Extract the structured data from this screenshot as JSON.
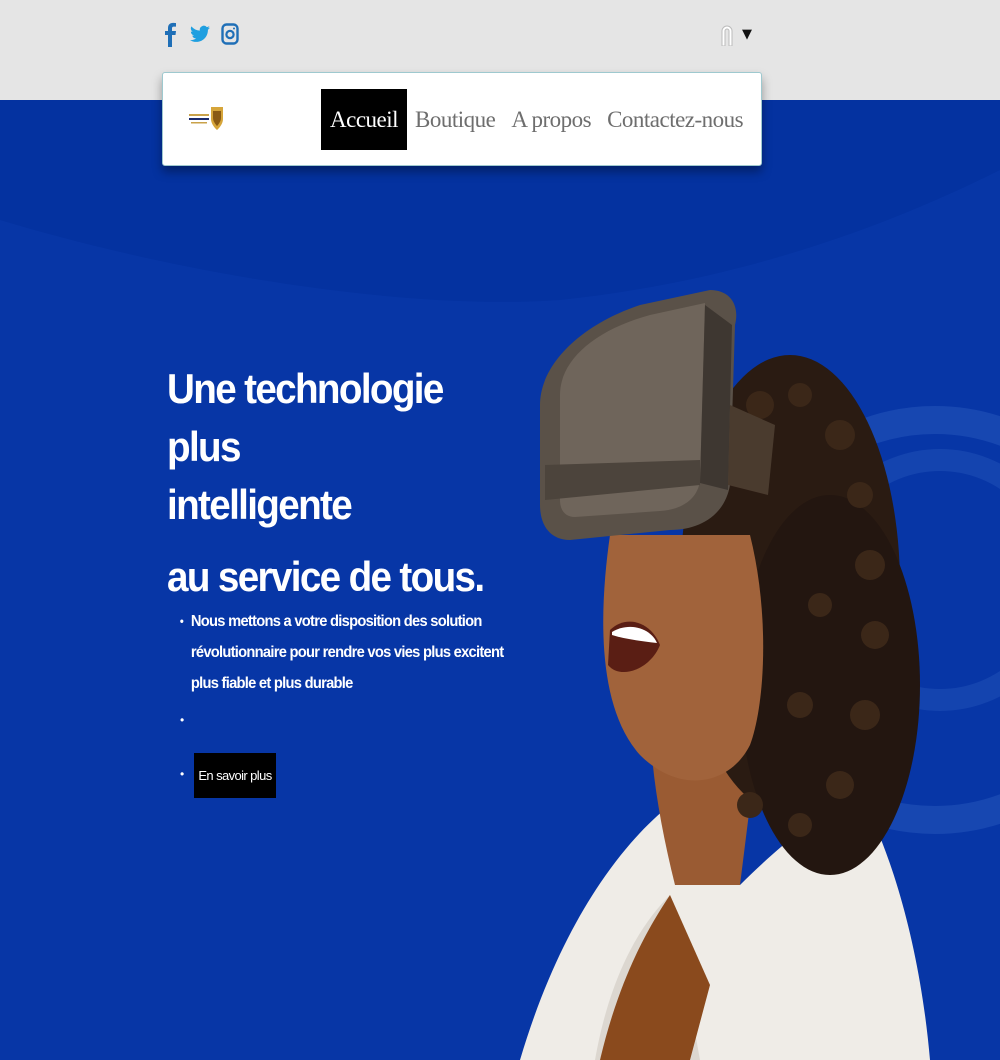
{
  "social": {
    "icons": [
      "facebook-icon",
      "twitter-icon",
      "instagram-icon"
    ],
    "color": "#1f6fb7"
  },
  "user_menu": {
    "icon": "user-icon",
    "caret": "▼"
  },
  "nav": {
    "logo": "brand-logo",
    "items": [
      {
        "label": "Accueil",
        "active": true
      },
      {
        "label": "Boutique",
        "active": false
      },
      {
        "label": "A propos",
        "active": false
      },
      {
        "label": "Contactez-nous",
        "active": false
      }
    ]
  },
  "hero": {
    "headline_line1": "Une technologie plus",
    "headline_line2": "intelligente",
    "headline_line3": "au service de tous.",
    "bullet_line1": "Nous mettons a votre disposition des solution",
    "bullet_line2": "révolutionnaire pour rendre vos vies plus excitent",
    "bullet_line3": " plus fiable et plus durable",
    "cta_label": "En savoir plus",
    "bullet_marker": "•"
  },
  "colors": {
    "hero_bg": "#0432a0",
    "topbar_bg": "#e5e5e5",
    "nav_active_bg": "#000000",
    "nav_text": "#6e6e6e"
  }
}
